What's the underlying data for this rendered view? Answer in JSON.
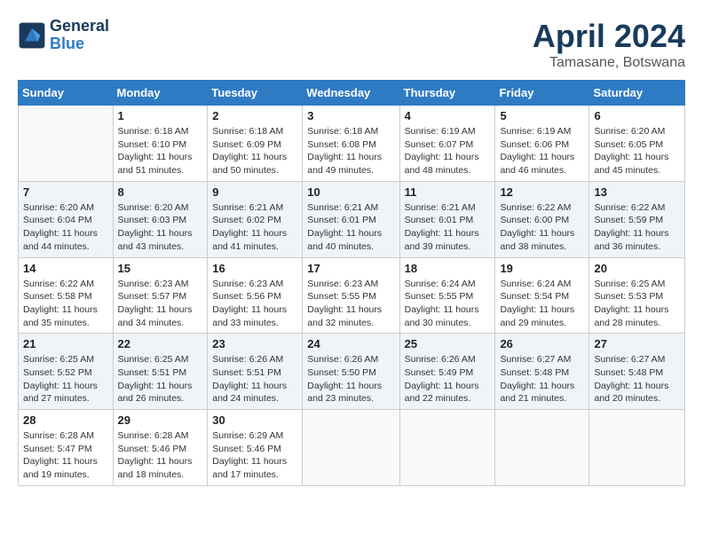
{
  "logo": {
    "line1": "General",
    "line2": "Blue"
  },
  "title": "April 2024",
  "subtitle": "Tamasane, Botswana",
  "days_of_week": [
    "Sunday",
    "Monday",
    "Tuesday",
    "Wednesday",
    "Thursday",
    "Friday",
    "Saturday"
  ],
  "weeks": [
    [
      {
        "day": "",
        "info": ""
      },
      {
        "day": "1",
        "info": "Sunrise: 6:18 AM\nSunset: 6:10 PM\nDaylight: 11 hours\nand 51 minutes."
      },
      {
        "day": "2",
        "info": "Sunrise: 6:18 AM\nSunset: 6:09 PM\nDaylight: 11 hours\nand 50 minutes."
      },
      {
        "day": "3",
        "info": "Sunrise: 6:18 AM\nSunset: 6:08 PM\nDaylight: 11 hours\nand 49 minutes."
      },
      {
        "day": "4",
        "info": "Sunrise: 6:19 AM\nSunset: 6:07 PM\nDaylight: 11 hours\nand 48 minutes."
      },
      {
        "day": "5",
        "info": "Sunrise: 6:19 AM\nSunset: 6:06 PM\nDaylight: 11 hours\nand 46 minutes."
      },
      {
        "day": "6",
        "info": "Sunrise: 6:20 AM\nSunset: 6:05 PM\nDaylight: 11 hours\nand 45 minutes."
      }
    ],
    [
      {
        "day": "7",
        "info": "Sunrise: 6:20 AM\nSunset: 6:04 PM\nDaylight: 11 hours\nand 44 minutes."
      },
      {
        "day": "8",
        "info": "Sunrise: 6:20 AM\nSunset: 6:03 PM\nDaylight: 11 hours\nand 43 minutes."
      },
      {
        "day": "9",
        "info": "Sunrise: 6:21 AM\nSunset: 6:02 PM\nDaylight: 11 hours\nand 41 minutes."
      },
      {
        "day": "10",
        "info": "Sunrise: 6:21 AM\nSunset: 6:01 PM\nDaylight: 11 hours\nand 40 minutes."
      },
      {
        "day": "11",
        "info": "Sunrise: 6:21 AM\nSunset: 6:01 PM\nDaylight: 11 hours\nand 39 minutes."
      },
      {
        "day": "12",
        "info": "Sunrise: 6:22 AM\nSunset: 6:00 PM\nDaylight: 11 hours\nand 38 minutes."
      },
      {
        "day": "13",
        "info": "Sunrise: 6:22 AM\nSunset: 5:59 PM\nDaylight: 11 hours\nand 36 minutes."
      }
    ],
    [
      {
        "day": "14",
        "info": "Sunrise: 6:22 AM\nSunset: 5:58 PM\nDaylight: 11 hours\nand 35 minutes."
      },
      {
        "day": "15",
        "info": "Sunrise: 6:23 AM\nSunset: 5:57 PM\nDaylight: 11 hours\nand 34 minutes."
      },
      {
        "day": "16",
        "info": "Sunrise: 6:23 AM\nSunset: 5:56 PM\nDaylight: 11 hours\nand 33 minutes."
      },
      {
        "day": "17",
        "info": "Sunrise: 6:23 AM\nSunset: 5:55 PM\nDaylight: 11 hours\nand 32 minutes."
      },
      {
        "day": "18",
        "info": "Sunrise: 6:24 AM\nSunset: 5:55 PM\nDaylight: 11 hours\nand 30 minutes."
      },
      {
        "day": "19",
        "info": "Sunrise: 6:24 AM\nSunset: 5:54 PM\nDaylight: 11 hours\nand 29 minutes."
      },
      {
        "day": "20",
        "info": "Sunrise: 6:25 AM\nSunset: 5:53 PM\nDaylight: 11 hours\nand 28 minutes."
      }
    ],
    [
      {
        "day": "21",
        "info": "Sunrise: 6:25 AM\nSunset: 5:52 PM\nDaylight: 11 hours\nand 27 minutes."
      },
      {
        "day": "22",
        "info": "Sunrise: 6:25 AM\nSunset: 5:51 PM\nDaylight: 11 hours\nand 26 minutes."
      },
      {
        "day": "23",
        "info": "Sunrise: 6:26 AM\nSunset: 5:51 PM\nDaylight: 11 hours\nand 24 minutes."
      },
      {
        "day": "24",
        "info": "Sunrise: 6:26 AM\nSunset: 5:50 PM\nDaylight: 11 hours\nand 23 minutes."
      },
      {
        "day": "25",
        "info": "Sunrise: 6:26 AM\nSunset: 5:49 PM\nDaylight: 11 hours\nand 22 minutes."
      },
      {
        "day": "26",
        "info": "Sunrise: 6:27 AM\nSunset: 5:48 PM\nDaylight: 11 hours\nand 21 minutes."
      },
      {
        "day": "27",
        "info": "Sunrise: 6:27 AM\nSunset: 5:48 PM\nDaylight: 11 hours\nand 20 minutes."
      }
    ],
    [
      {
        "day": "28",
        "info": "Sunrise: 6:28 AM\nSunset: 5:47 PM\nDaylight: 11 hours\nand 19 minutes."
      },
      {
        "day": "29",
        "info": "Sunrise: 6:28 AM\nSunset: 5:46 PM\nDaylight: 11 hours\nand 18 minutes."
      },
      {
        "day": "30",
        "info": "Sunrise: 6:29 AM\nSunset: 5:46 PM\nDaylight: 11 hours\nand 17 minutes."
      },
      {
        "day": "",
        "info": ""
      },
      {
        "day": "",
        "info": ""
      },
      {
        "day": "",
        "info": ""
      },
      {
        "day": "",
        "info": ""
      }
    ]
  ]
}
